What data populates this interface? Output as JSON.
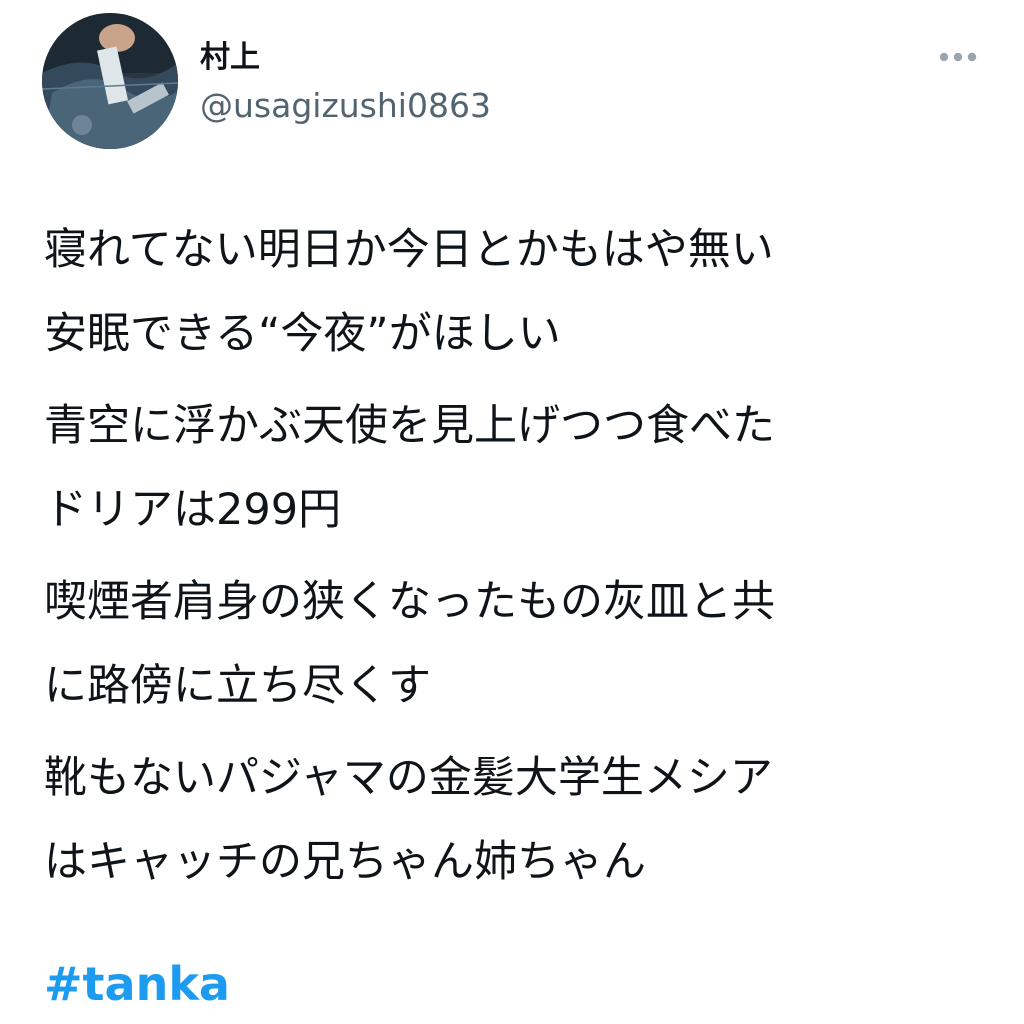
{
  "author": {
    "display_name": "村上",
    "handle": "@usagizushi0863"
  },
  "more_icon": "more-horizontal-icon",
  "tweet": {
    "stanzas": [
      [
        "寝れてない明日か今日とかもはや無い",
        "安眠できる“今夜”がほしい"
      ],
      [
        "青空に浮かぶ天使を見上げつつ食べた",
        "ドリアは299円"
      ],
      [
        "喫煙者肩身の狭くなったもの灰皿と共",
        "に路傍に立ち尽くす"
      ],
      [
        "靴もないパジャマの金髪大学生メシア",
        "はキャッチの兄ちゃん姉ちゃん"
      ]
    ],
    "hashtag": "#tanka"
  },
  "colors": {
    "text": "#0f1419",
    "secondary": "#536471",
    "link": "#1d9bf0"
  }
}
